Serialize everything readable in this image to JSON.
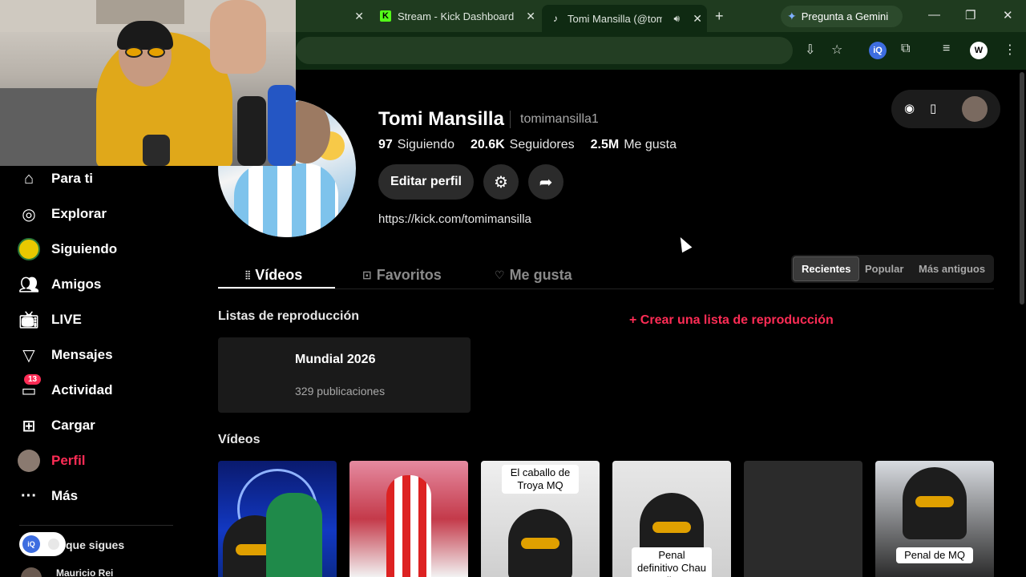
{
  "browser": {
    "tabs": [
      {
        "title": ""
      },
      {
        "title": "Stream - Kick Dashboard",
        "favicon": "kick-icon"
      },
      {
        "title": "Tomi Mansilla (@tomi",
        "favicon": "tiktok-icon",
        "audible": true
      }
    ],
    "gemini_label": "Pregunta a Gemini"
  },
  "sidebar": {
    "items": [
      {
        "label": "Para ti",
        "icon": "home-icon"
      },
      {
        "label": "Explorar",
        "icon": "compass-icon"
      },
      {
        "label": "Siguiendo",
        "icon": "following-avatar-icon"
      },
      {
        "label": "Amigos",
        "icon": "friends-icon"
      },
      {
        "label": "LIVE",
        "icon": "live-tv-icon"
      },
      {
        "label": "Mensajes",
        "icon": "send-icon"
      },
      {
        "label": "Actividad",
        "icon": "inbox-icon",
        "badge": "13"
      },
      {
        "label": "Cargar",
        "icon": "upload-plus-icon"
      },
      {
        "label": "Perfil",
        "icon": "profile-avatar-icon",
        "active": true
      },
      {
        "label": "Más",
        "icon": "more-dots-icon"
      }
    ],
    "following_label": "que sigues",
    "following_user": "Mauricio Rei"
  },
  "profile": {
    "name": "Tomi Mansilla",
    "handle": "tomimansilla1",
    "stats": [
      {
        "value": "97",
        "label": "Siguiendo"
      },
      {
        "value": "20.6K",
        "label": "Seguidores"
      },
      {
        "value": "2.5M",
        "label": "Me gusta"
      }
    ],
    "edit_label": "Editar perfil",
    "bio_link": "https://kick.com/tomimansilla"
  },
  "tabs": [
    {
      "label": "Vídeos",
      "icon": "grid-icon",
      "active": true
    },
    {
      "label": "Favoritos",
      "icon": "bookmark-icon"
    },
    {
      "label": "Me gusta",
      "icon": "heart-icon"
    }
  ],
  "sort": [
    {
      "label": "Recientes",
      "active": true
    },
    {
      "label": "Popular"
    },
    {
      "label": "Más antiguos"
    }
  ],
  "playlists": {
    "title": "Listas de reproducción",
    "create_label": "+ Crear una lista de reproducción",
    "items": [
      {
        "name": "Mundial 2026",
        "count": "329 publicaciones"
      }
    ]
  },
  "videos": {
    "title": "Vídeos",
    "items": [
      {
        "caption": ""
      },
      {
        "caption": ""
      },
      {
        "caption": "El caballo de Troya MQ"
      },
      {
        "caption": "Penal definitivo Chau Riber"
      },
      {
        "caption": ""
      },
      {
        "caption": "Penal de MQ"
      }
    ]
  },
  "colors": {
    "accent": "#fe2c55",
    "chrome_tabbar": "#1f3b1f",
    "chrome_toolbar": "#0f2a12",
    "kick_green": "#53fc18"
  }
}
